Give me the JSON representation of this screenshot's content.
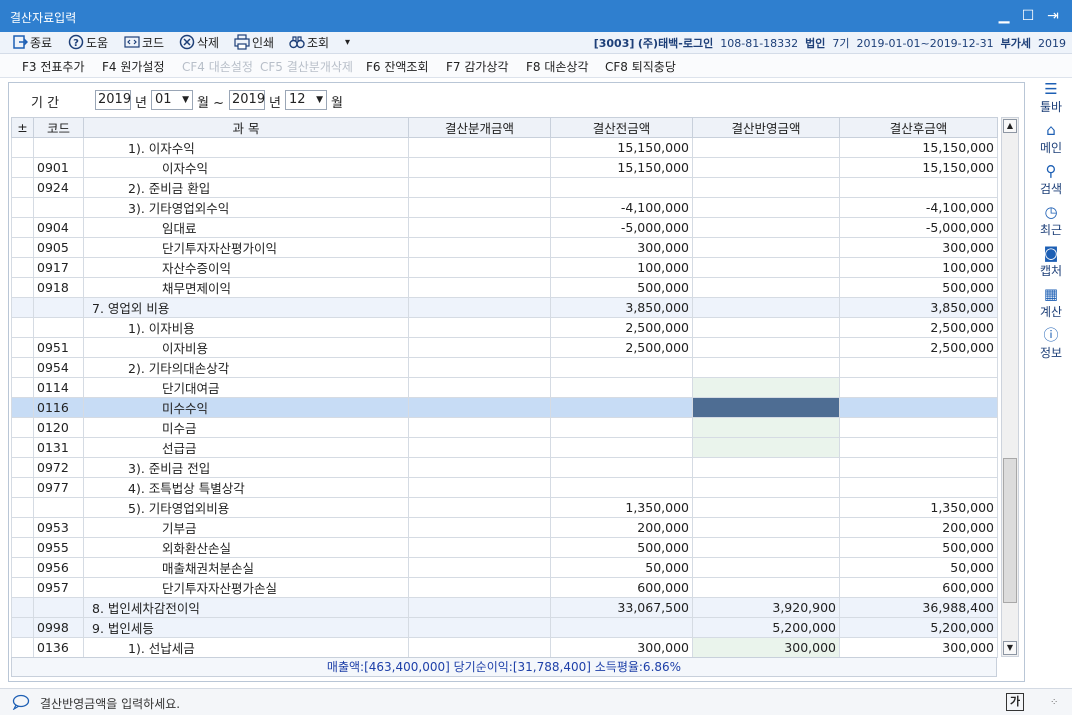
{
  "window": {
    "title": "결산자료입력"
  },
  "menu": {
    "items": [
      {
        "label": "종료",
        "icon": "exit-icon"
      },
      {
        "label": "도움",
        "icon": "help-icon"
      },
      {
        "label": "코드",
        "icon": "code-icon"
      },
      {
        "label": "삭제",
        "icon": "delete-icon"
      },
      {
        "label": "인쇄",
        "icon": "print-icon"
      },
      {
        "label": "조회",
        "icon": "binoculars-icon"
      }
    ],
    "more": "▾",
    "company_code": "[3003]",
    "company_name": "(주)태백-로그인",
    "biz_no": "108-81-18332",
    "type": "법인",
    "term": "7기",
    "period": "2019-01-01~2019-12-31",
    "tax_label": "부가세",
    "tax_year": "2019"
  },
  "fkeys": [
    {
      "label": "F3 전표추가",
      "enabled": true
    },
    {
      "label": "F4 원가설정",
      "enabled": true
    },
    {
      "label": "CF4 대손설정",
      "enabled": false
    },
    {
      "label": "CF5 결산분개삭제",
      "enabled": false
    },
    {
      "label": "F6 잔액조회",
      "enabled": true
    },
    {
      "label": "F7 감가상각",
      "enabled": true
    },
    {
      "label": "F8 대손상각",
      "enabled": true
    },
    {
      "label": "CF8 퇴직충당",
      "enabled": true
    }
  ],
  "period": {
    "label": "기    간",
    "from_year": "2019",
    "year_unit": "년",
    "from_month": "01",
    "month_unit": "월 ~",
    "to_year": "2019",
    "to_month": "12",
    "end_unit": "월"
  },
  "grid": {
    "headers": [
      "±",
      "코드",
      "과          목",
      "결산분개금액",
      "결산전금액",
      "결산반영금액",
      "결산후금액"
    ],
    "rows": [
      {
        "code": "",
        "subject": "1). 이자수익",
        "indent": 2,
        "journal": "",
        "before": "15,150,000",
        "reflect": "",
        "after": "15,150,000"
      },
      {
        "code": "0901",
        "subject": "이자수익",
        "indent": 3,
        "journal": "",
        "before": "15,150,000",
        "reflect": "",
        "after": "15,150,000"
      },
      {
        "code": "0924",
        "subject": "2). 준비금 환입",
        "indent": 2,
        "journal": "",
        "before": "",
        "reflect": "",
        "after": ""
      },
      {
        "code": "",
        "subject": "3). 기타영업외수익",
        "indent": 2,
        "journal": "",
        "before": "-4,100,000",
        "reflect": "",
        "after": "-4,100,000"
      },
      {
        "code": "0904",
        "subject": "임대료",
        "indent": 3,
        "journal": "",
        "before": "-5,000,000",
        "reflect": "",
        "after": "-5,000,000"
      },
      {
        "code": "0905",
        "subject": "단기투자자산평가이익",
        "indent": 3,
        "journal": "",
        "before": "300,000",
        "reflect": "",
        "after": "300,000"
      },
      {
        "code": "0917",
        "subject": "자산수증이익",
        "indent": 3,
        "journal": "",
        "before": "100,000",
        "reflect": "",
        "after": "100,000"
      },
      {
        "code": "0918",
        "subject": "채무면제이익",
        "indent": 3,
        "journal": "",
        "before": "500,000",
        "reflect": "",
        "after": "500,000"
      },
      {
        "code": "",
        "subject": "7. 영업외 비용",
        "indent": 1,
        "journal": "",
        "before": "3,850,000",
        "reflect": "",
        "after": "3,850,000",
        "style": "subtotal"
      },
      {
        "code": "",
        "subject": "1). 이자비용",
        "indent": 2,
        "journal": "",
        "before": "2,500,000",
        "reflect": "",
        "after": "2,500,000"
      },
      {
        "code": "0951",
        "subject": "이자비용",
        "indent": 3,
        "journal": "",
        "before": "2,500,000",
        "reflect": "",
        "after": "2,500,000"
      },
      {
        "code": "0954",
        "subject": "2). 기타의대손상각",
        "indent": 2,
        "journal": "",
        "before": "",
        "reflect": "",
        "after": ""
      },
      {
        "code": "0114",
        "subject": "단기대여금",
        "indent": 3,
        "journal": "",
        "before": "",
        "reflect": "",
        "after": "",
        "editable": true
      },
      {
        "code": "0116",
        "subject": "미수수익",
        "indent": 3,
        "journal": "",
        "before": "",
        "reflect": "",
        "after": "",
        "editable": true,
        "style": "selected"
      },
      {
        "code": "0120",
        "subject": "미수금",
        "indent": 3,
        "journal": "",
        "before": "",
        "reflect": "",
        "after": "",
        "editable": true
      },
      {
        "code": "0131",
        "subject": "선급금",
        "indent": 3,
        "journal": "",
        "before": "",
        "reflect": "",
        "after": "",
        "editable": true
      },
      {
        "code": "0972",
        "subject": "3). 준비금 전입",
        "indent": 2,
        "journal": "",
        "before": "",
        "reflect": "",
        "after": ""
      },
      {
        "code": "0977",
        "subject": "4). 조특법상 특별상각",
        "indent": 2,
        "journal": "",
        "before": "",
        "reflect": "",
        "after": ""
      },
      {
        "code": "",
        "subject": "5). 기타영업외비용",
        "indent": 2,
        "journal": "",
        "before": "1,350,000",
        "reflect": "",
        "after": "1,350,000"
      },
      {
        "code": "0953",
        "subject": "기부금",
        "indent": 3,
        "journal": "",
        "before": "200,000",
        "reflect": "",
        "after": "200,000"
      },
      {
        "code": "0955",
        "subject": "외화환산손실",
        "indent": 3,
        "journal": "",
        "before": "500,000",
        "reflect": "",
        "after": "500,000"
      },
      {
        "code": "0956",
        "subject": "매출채권처분손실",
        "indent": 3,
        "journal": "",
        "before": "50,000",
        "reflect": "",
        "after": "50,000"
      },
      {
        "code": "0957",
        "subject": "단기투자자산평가손실",
        "indent": 3,
        "journal": "",
        "before": "600,000",
        "reflect": "",
        "after": "600,000"
      },
      {
        "code": "",
        "subject": "8. 법인세차감전이익",
        "indent": 1,
        "journal": "",
        "before": "33,067,500",
        "reflect": "3,920,900",
        "after": "36,988,400",
        "style": "subtotal"
      },
      {
        "code": "0998",
        "subject": "9. 법인세등",
        "indent": 1,
        "journal": "",
        "before": "",
        "reflect": "5,200,000",
        "after": "5,200,000",
        "style": "subtotal"
      },
      {
        "code": "0136",
        "subject": "1). 선납세금",
        "indent": 2,
        "journal": "",
        "before": "300,000",
        "reflect": "300,000",
        "after": "300,000",
        "editable": true
      }
    ]
  },
  "summary": "매출액:[463,400,000] 당기순이익:[31,788,400] 소득평율:6.86%",
  "sidebar": [
    {
      "label": "툴바",
      "icon": "hamburger-icon",
      "glyph": "☰"
    },
    {
      "label": "메인",
      "icon": "home-icon",
      "glyph": "⌂"
    },
    {
      "label": "검색",
      "icon": "search-icon",
      "glyph": "⚲"
    },
    {
      "label": "최근",
      "icon": "clock-icon",
      "glyph": "◷"
    },
    {
      "label": "캡처",
      "icon": "camera-icon",
      "glyph": "◙"
    },
    {
      "label": "계산",
      "icon": "calculator-icon",
      "glyph": "▦"
    },
    {
      "label": "정보",
      "icon": "info-icon",
      "glyph": "ⓘ"
    }
  ],
  "status": {
    "message": "결산반영금액을 입력하세요.",
    "ime": "가"
  },
  "colors": {
    "titlebar": "#2f7fcf",
    "selected_row": "#c7dcf5",
    "active_cell": "#4e6d93",
    "editable_cell": "#eaf4ec",
    "summary_text": "#1d3fa8"
  }
}
